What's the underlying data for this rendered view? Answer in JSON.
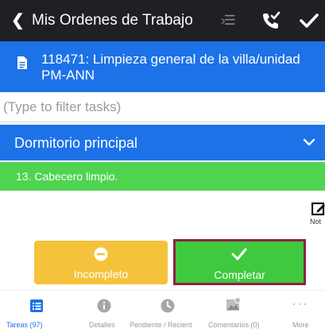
{
  "topbar": {
    "back_glyph": "❮",
    "title": "Mis Ordenes de Trabajo",
    "icons": [
      "back-icon",
      "list-icon",
      "phone-check-icon",
      "check-icon"
    ]
  },
  "work_order": {
    "title_line1": "118471: Limpieza general de la villa/unidad",
    "title_line2": "PM-ANN"
  },
  "filter": {
    "placeholder": "(Type to filter tasks)"
  },
  "section": {
    "label": "Dormitorio principal"
  },
  "task": {
    "label": "13. Cabecero limpio."
  },
  "notes": {
    "label": "Not"
  },
  "actions": {
    "incomplete_label": "Incompleto",
    "complete_label": "Completar"
  },
  "tabs": [
    {
      "label": "Tareas (97)",
      "icon": "list-icon",
      "active": true
    },
    {
      "label": "Detalles",
      "icon": "info-icon",
      "active": false
    },
    {
      "label": "Pendiente / Recient",
      "icon": "clock-icon",
      "active": false
    },
    {
      "label": "Comentarios (0)",
      "icon": "image-icon",
      "active": false
    },
    {
      "label": "More",
      "icon": "more-icon",
      "active": false
    }
  ],
  "colors": {
    "topbar": "#1f2023",
    "primary_blue": "#1d72e8",
    "task_green": "#4fd44f",
    "incomplete_yellow": "#f5c23b",
    "complete_green": "#3ec93e",
    "complete_border": "#8c2445",
    "active_tab": "#1d72e8"
  }
}
